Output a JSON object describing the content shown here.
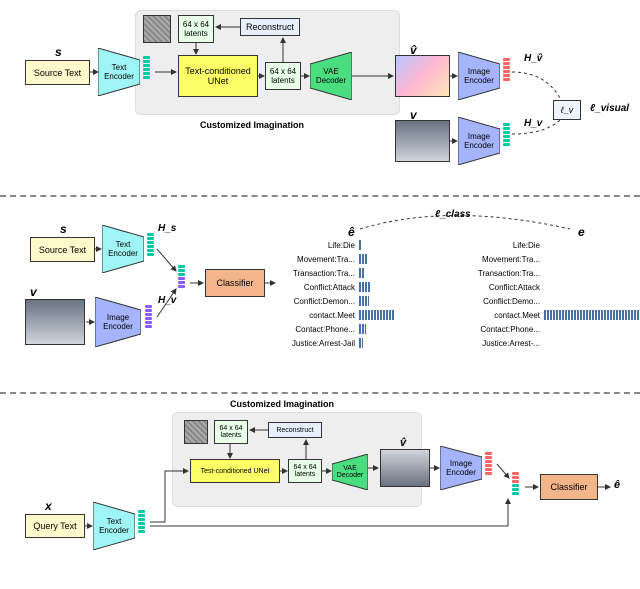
{
  "panel1": {
    "s_symbol": "s",
    "vhat_symbol": "v̂",
    "v_symbol": "v",
    "source_text": "Source Text",
    "text_encoder": "Text Encoder",
    "unet": "Text-conditioned UNet",
    "latents_a": "64 x 64 latents",
    "latents_b": "64 x 64 latents",
    "reconstruct": "Reconstruct",
    "vae_decoder": "VAE Decoder",
    "image_encoder": "Image Encoder",
    "Hvhat": "H_v̂",
    "Hv": "H_v",
    "loss_visual_box": "ℓ_v",
    "loss_visual": "ℓ_visual",
    "ci_label": "Customized Imagination"
  },
  "panel2": {
    "s_symbol": "s",
    "v_symbol": "v",
    "source_text": "Source Text",
    "text_encoder": "Text Encoder",
    "image_encoder": "Image Encoder",
    "Hs": "H_s",
    "Hv": "H_v",
    "classifier": "Classifier",
    "ehat_symbol": "ê",
    "e_symbol": "e",
    "loss_class": "ℓ_class"
  },
  "panel3": {
    "x_symbol": "x",
    "query_text": "Query Text",
    "text_encoder": "Text Encoder",
    "ci_label": "Customized Imagination",
    "unet": "Test-conditioned UNet",
    "latents_a": "64 x 64 latents",
    "latents_b": "64 x 64 latents",
    "reconstruct": "Reconstruct",
    "vae_decoder": "VAE Decoder",
    "vhat_symbol": "v̂",
    "image_encoder": "Image Encoder",
    "classifier": "Classifier",
    "ehat_symbol": "ê"
  },
  "chart_data": [
    {
      "type": "bar",
      "title": "ê",
      "orientation": "horizontal",
      "categories": [
        "Life:Die",
        "Movement:Tra...",
        "Transaction:Tra...",
        "Conflict:Attack",
        "Conflict:Demon...",
        "contact.Meet",
        "Contact:Phone...",
        "Justice:Arrest-Jail"
      ],
      "values": [
        3,
        8,
        5,
        12,
        10,
        35,
        7,
        4
      ],
      "ylim": [
        0,
        100
      ]
    },
    {
      "type": "bar",
      "title": "e",
      "orientation": "horizontal",
      "categories": [
        "Life:Die",
        "Movement:Tra...",
        "Transaction:Tra...",
        "Conflict:Attack",
        "Conflict:Demo...",
        "contact.Meet",
        "Contact:Phone...",
        "Justice:Arrest-..."
      ],
      "values": [
        0,
        0,
        0,
        0,
        0,
        100,
        0,
        0
      ],
      "ylim": [
        0,
        100
      ]
    }
  ]
}
